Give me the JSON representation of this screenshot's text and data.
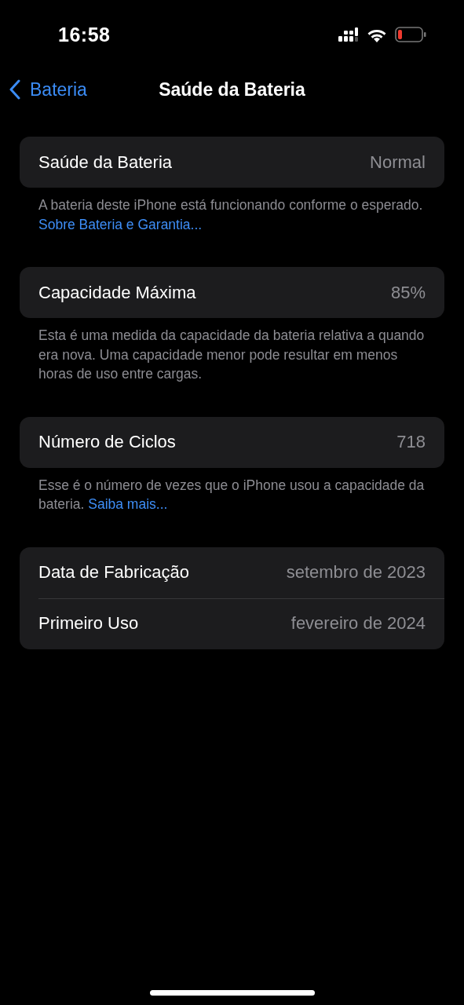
{
  "status_bar": {
    "time": "16:58"
  },
  "nav": {
    "back": "Bateria",
    "title": "Saúde da Bateria"
  },
  "sections": [
    {
      "rows": [
        {
          "label": "Saúde da Bateria",
          "value": "Normal"
        }
      ],
      "footer": {
        "text": "A bateria deste iPhone está funcionando conforme o esperado.",
        "link": "Sobre Bateria e Garantia..."
      }
    },
    {
      "rows": [
        {
          "label": "Capacidade Máxima",
          "value": "85%"
        }
      ],
      "footer": {
        "text": "Esta é uma medida da capacidade da bateria relativa a quando era nova. Uma capacidade menor pode resultar em menos horas de uso entre cargas."
      }
    },
    {
      "rows": [
        {
          "label": "Número de Ciclos",
          "value": "718"
        }
      ],
      "footer": {
        "text": "Esse é o número de vezes que o iPhone usou a capacidade da bateria.",
        "link": "Saiba mais..."
      }
    },
    {
      "rows": [
        {
          "label": "Data de Fabricação",
          "value": "setembro de 2023"
        },
        {
          "label": "Primeiro Uso",
          "value": "fevereiro de 2024"
        }
      ]
    }
  ]
}
